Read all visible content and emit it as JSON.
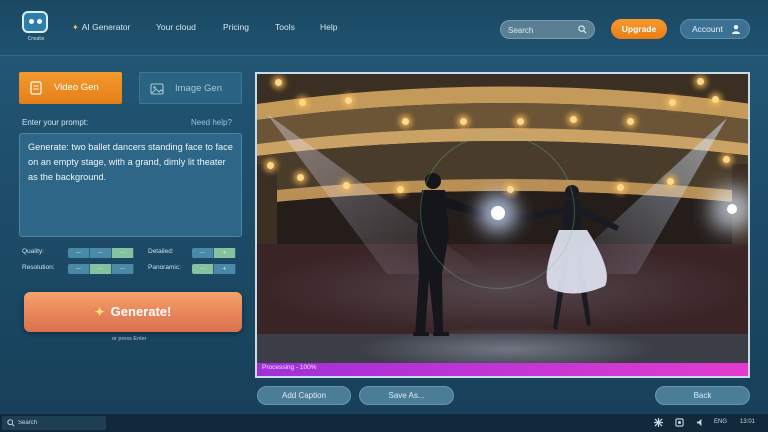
{
  "nav": {
    "logo_caption": "Create",
    "links": [
      "AI Generator",
      "Your cloud",
      "Pricing",
      "Tools",
      "Help"
    ],
    "search_placeholder": "Search",
    "upgrade_label": "Upgrade",
    "account_label": "Account"
  },
  "tabs": {
    "video": "Video Gen",
    "image": "Image Gen",
    "active": "video"
  },
  "prompt": {
    "label": "Enter your prompt:",
    "help_link": "Need help?",
    "text": "Generate: two ballet dancers standing face to face on an empty stage, with a grand, dimly lit theater as the background."
  },
  "options": {
    "quality": {
      "label": "Quality:",
      "segments": 3,
      "selected_index": 2
    },
    "resolution": {
      "label": "Resolution:",
      "segments": 3,
      "selected_index": 1
    },
    "detailed": {
      "label": "Detailed:",
      "segments": 2,
      "selected_index": 1
    },
    "panoramic": {
      "label": "Panoramic:",
      "segments": 2,
      "selected_index": 0
    }
  },
  "generate": {
    "label": "Generate!",
    "hint": "or press Enter"
  },
  "preview": {
    "progress_text": "Processing - 100%",
    "progress": 1.0
  },
  "actions": {
    "add_caption": "Add Caption",
    "save_as": "Save As...",
    "back": "Back"
  },
  "taskbar": {
    "search_placeholder": "Search",
    "lang": "ENG",
    "time": "13:01"
  },
  "colors": {
    "accent_orange": "#ea7d16",
    "generate_gradient_top": "#f4a36a",
    "progress_fill": "#e43bd0",
    "panel_bg": "#2d6686"
  }
}
